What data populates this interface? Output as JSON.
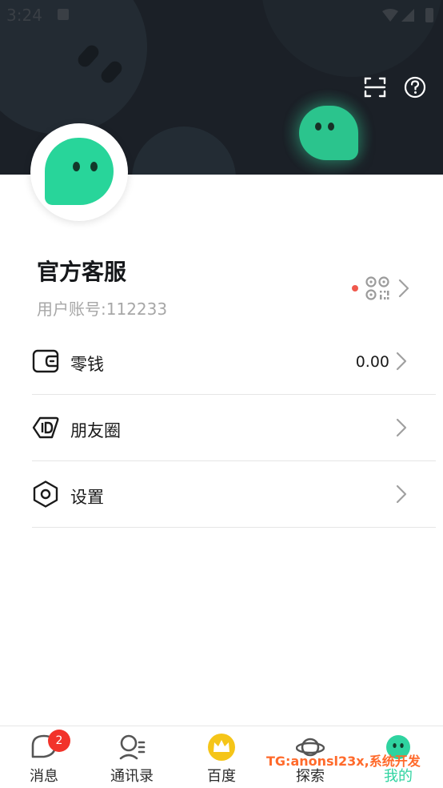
{
  "status_bar": {
    "time": "3:24"
  },
  "profile": {
    "name": "官方客服",
    "account_label": "用户账号:",
    "account_number": "112233"
  },
  "menu": {
    "items": [
      {
        "label": "零钱",
        "value": "0.00",
        "icon": "wallet-icon"
      },
      {
        "label": "朋友圈",
        "value": "",
        "icon": "id-tag-icon"
      },
      {
        "label": "设置",
        "value": "",
        "icon": "hexagon-settings-icon"
      }
    ]
  },
  "bottom_nav": {
    "items": [
      {
        "label": "消息",
        "icon": "chat-bubble-icon",
        "badge": "2"
      },
      {
        "label": "通讯录",
        "icon": "contacts-icon"
      },
      {
        "label": "百度",
        "icon": "crown-icon"
      },
      {
        "label": "探索",
        "icon": "planet-icon"
      },
      {
        "label": "我的",
        "icon": "ghost-icon",
        "active": true
      }
    ]
  },
  "watermark": "TG:anonsl23x,系统开发",
  "colors": {
    "accent": "#2fd3a0",
    "header_bg": "#1b2027",
    "badge": "#f2332a",
    "dot": "#f0594d"
  }
}
